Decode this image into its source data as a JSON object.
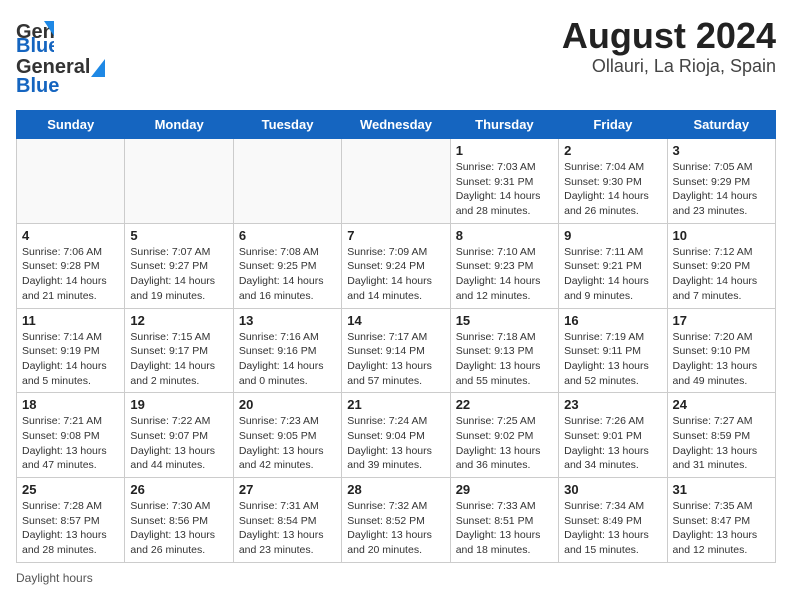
{
  "header": {
    "logo_general": "General",
    "logo_blue": "Blue",
    "title": "August 2024",
    "subtitle": "Ollauri, La Rioja, Spain"
  },
  "days_of_week": [
    "Sunday",
    "Monday",
    "Tuesday",
    "Wednesday",
    "Thursday",
    "Friday",
    "Saturday"
  ],
  "footer": {
    "daylight_label": "Daylight hours"
  },
  "weeks": [
    [
      {
        "day": "",
        "info": ""
      },
      {
        "day": "",
        "info": ""
      },
      {
        "day": "",
        "info": ""
      },
      {
        "day": "",
        "info": ""
      },
      {
        "day": "1",
        "info": "Sunrise: 7:03 AM\nSunset: 9:31 PM\nDaylight: 14 hours and 28 minutes."
      },
      {
        "day": "2",
        "info": "Sunrise: 7:04 AM\nSunset: 9:30 PM\nDaylight: 14 hours and 26 minutes."
      },
      {
        "day": "3",
        "info": "Sunrise: 7:05 AM\nSunset: 9:29 PM\nDaylight: 14 hours and 23 minutes."
      }
    ],
    [
      {
        "day": "4",
        "info": "Sunrise: 7:06 AM\nSunset: 9:28 PM\nDaylight: 14 hours and 21 minutes."
      },
      {
        "day": "5",
        "info": "Sunrise: 7:07 AM\nSunset: 9:27 PM\nDaylight: 14 hours and 19 minutes."
      },
      {
        "day": "6",
        "info": "Sunrise: 7:08 AM\nSunset: 9:25 PM\nDaylight: 14 hours and 16 minutes."
      },
      {
        "day": "7",
        "info": "Sunrise: 7:09 AM\nSunset: 9:24 PM\nDaylight: 14 hours and 14 minutes."
      },
      {
        "day": "8",
        "info": "Sunrise: 7:10 AM\nSunset: 9:23 PM\nDaylight: 14 hours and 12 minutes."
      },
      {
        "day": "9",
        "info": "Sunrise: 7:11 AM\nSunset: 9:21 PM\nDaylight: 14 hours and 9 minutes."
      },
      {
        "day": "10",
        "info": "Sunrise: 7:12 AM\nSunset: 9:20 PM\nDaylight: 14 hours and 7 minutes."
      }
    ],
    [
      {
        "day": "11",
        "info": "Sunrise: 7:14 AM\nSunset: 9:19 PM\nDaylight: 14 hours and 5 minutes."
      },
      {
        "day": "12",
        "info": "Sunrise: 7:15 AM\nSunset: 9:17 PM\nDaylight: 14 hours and 2 minutes."
      },
      {
        "day": "13",
        "info": "Sunrise: 7:16 AM\nSunset: 9:16 PM\nDaylight: 14 hours and 0 minutes."
      },
      {
        "day": "14",
        "info": "Sunrise: 7:17 AM\nSunset: 9:14 PM\nDaylight: 13 hours and 57 minutes."
      },
      {
        "day": "15",
        "info": "Sunrise: 7:18 AM\nSunset: 9:13 PM\nDaylight: 13 hours and 55 minutes."
      },
      {
        "day": "16",
        "info": "Sunrise: 7:19 AM\nSunset: 9:11 PM\nDaylight: 13 hours and 52 minutes."
      },
      {
        "day": "17",
        "info": "Sunrise: 7:20 AM\nSunset: 9:10 PM\nDaylight: 13 hours and 49 minutes."
      }
    ],
    [
      {
        "day": "18",
        "info": "Sunrise: 7:21 AM\nSunset: 9:08 PM\nDaylight: 13 hours and 47 minutes."
      },
      {
        "day": "19",
        "info": "Sunrise: 7:22 AM\nSunset: 9:07 PM\nDaylight: 13 hours and 44 minutes."
      },
      {
        "day": "20",
        "info": "Sunrise: 7:23 AM\nSunset: 9:05 PM\nDaylight: 13 hours and 42 minutes."
      },
      {
        "day": "21",
        "info": "Sunrise: 7:24 AM\nSunset: 9:04 PM\nDaylight: 13 hours and 39 minutes."
      },
      {
        "day": "22",
        "info": "Sunrise: 7:25 AM\nSunset: 9:02 PM\nDaylight: 13 hours and 36 minutes."
      },
      {
        "day": "23",
        "info": "Sunrise: 7:26 AM\nSunset: 9:01 PM\nDaylight: 13 hours and 34 minutes."
      },
      {
        "day": "24",
        "info": "Sunrise: 7:27 AM\nSunset: 8:59 PM\nDaylight: 13 hours and 31 minutes."
      }
    ],
    [
      {
        "day": "25",
        "info": "Sunrise: 7:28 AM\nSunset: 8:57 PM\nDaylight: 13 hours and 28 minutes."
      },
      {
        "day": "26",
        "info": "Sunrise: 7:30 AM\nSunset: 8:56 PM\nDaylight: 13 hours and 26 minutes."
      },
      {
        "day": "27",
        "info": "Sunrise: 7:31 AM\nSunset: 8:54 PM\nDaylight: 13 hours and 23 minutes."
      },
      {
        "day": "28",
        "info": "Sunrise: 7:32 AM\nSunset: 8:52 PM\nDaylight: 13 hours and 20 minutes."
      },
      {
        "day": "29",
        "info": "Sunrise: 7:33 AM\nSunset: 8:51 PM\nDaylight: 13 hours and 18 minutes."
      },
      {
        "day": "30",
        "info": "Sunrise: 7:34 AM\nSunset: 8:49 PM\nDaylight: 13 hours and 15 minutes."
      },
      {
        "day": "31",
        "info": "Sunrise: 7:35 AM\nSunset: 8:47 PM\nDaylight: 13 hours and 12 minutes."
      }
    ]
  ]
}
